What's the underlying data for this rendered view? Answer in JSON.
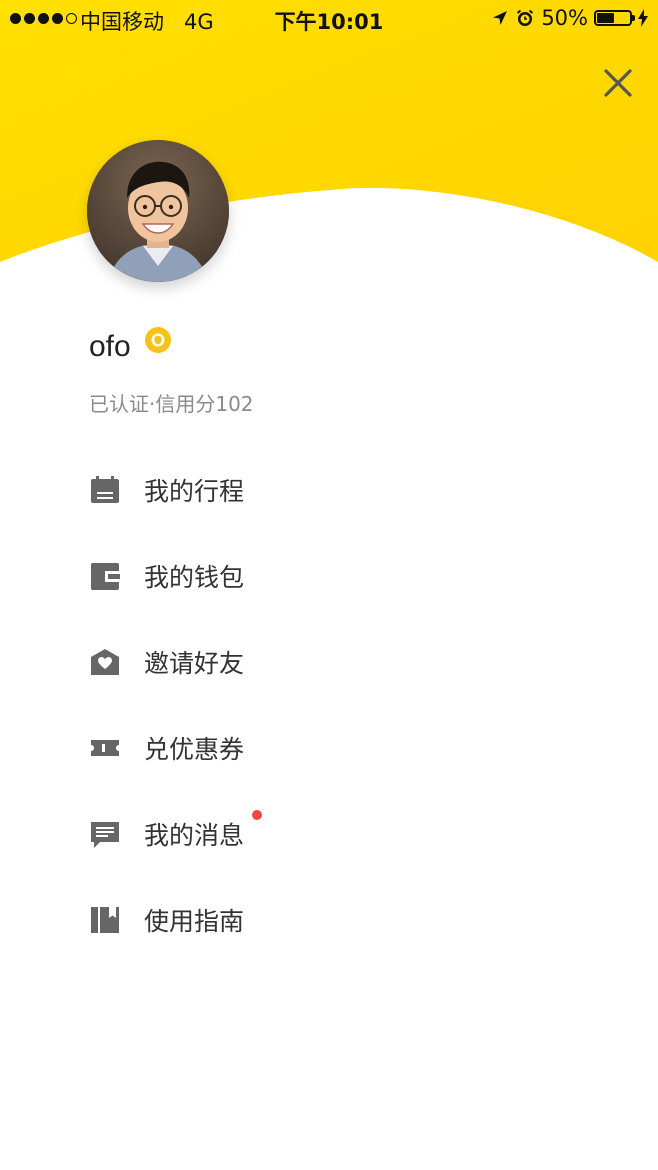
{
  "status_bar": {
    "carrier": "中国移动   4G",
    "time": "下午10:01",
    "battery": "50%",
    "battery_level": 0.5
  },
  "header": {
    "close_icon": "close-icon",
    "accent_color": "#ffde00"
  },
  "profile": {
    "name": "ofo",
    "badge_icon": "verified-badge-icon",
    "credit": "已认证·信用分102"
  },
  "menu": {
    "items": [
      {
        "label": "我的行程",
        "icon": "trip-icon"
      },
      {
        "label": "我的钱包",
        "icon": "wallet-icon"
      },
      {
        "label": "邀请好友",
        "icon": "invite-icon"
      },
      {
        "label": "兑优惠券",
        "icon": "coupon-icon"
      },
      {
        "label": "我的消息",
        "icon": "message-icon",
        "unread": true
      },
      {
        "label": "使用指南",
        "icon": "guide-icon"
      }
    ]
  }
}
